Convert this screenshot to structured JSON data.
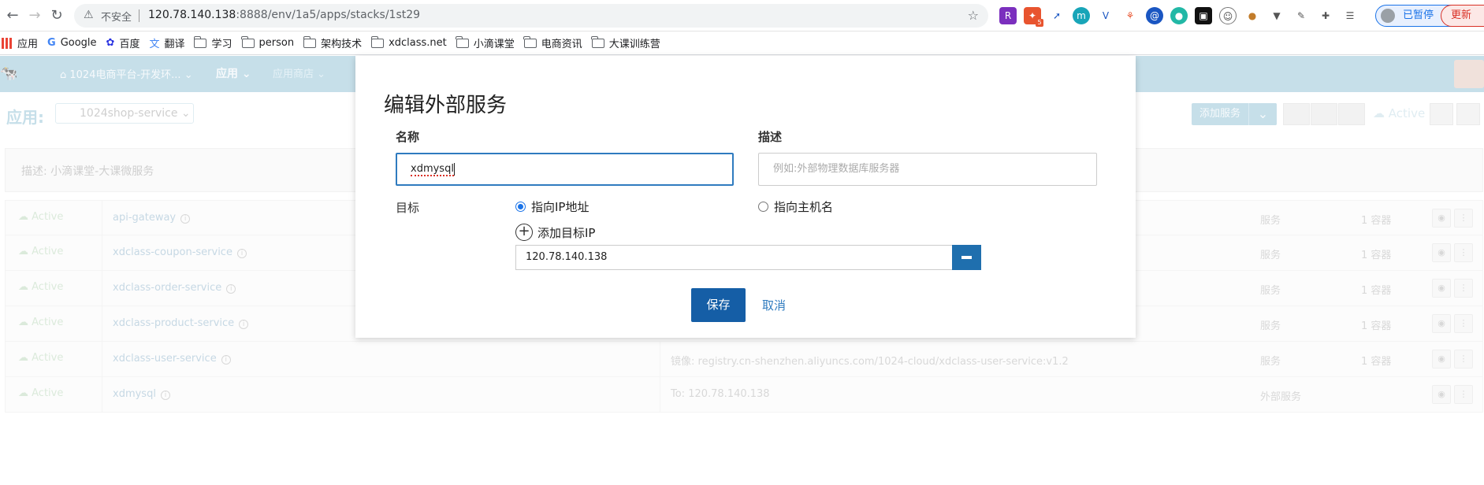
{
  "browser": {
    "insecure_label": "不安全",
    "url_host": "120.78.140.138",
    "url_rest": ":8888/env/1a5/apps/stacks/1st29",
    "paused_label": "已暂停",
    "update_label": "更新",
    "ext_badge": "5",
    "bookmarks": [
      {
        "label": "应用",
        "kind": "apps"
      },
      {
        "label": "Google",
        "kind": "google"
      },
      {
        "label": "百度",
        "kind": "baidu"
      },
      {
        "label": "翻译",
        "kind": "translate"
      },
      {
        "label": "学习",
        "kind": "folder"
      },
      {
        "label": "person",
        "kind": "folder"
      },
      {
        "label": "架构技术",
        "kind": "folder"
      },
      {
        "label": "xdclass.net",
        "kind": "folder"
      },
      {
        "label": "小滴课堂",
        "kind": "folder"
      },
      {
        "label": "电商资讯",
        "kind": "folder"
      },
      {
        "label": "大课训练营",
        "kind": "folder"
      }
    ]
  },
  "app": {
    "env_label": "1024电商平台-开发环...",
    "nav_apps": "应用",
    "nav_store": "应用商店",
    "page_title": "应用:",
    "stack_name": "1024shop-service",
    "add_service": "添加服务",
    "stack_state": "Active",
    "description": "描述: 小滴课堂-大课微服务",
    "services": [
      {
        "state": "Active",
        "name": "api-gateway",
        "detail": "",
        "kind": "服务",
        "scale": "1 容器"
      },
      {
        "state": "Active",
        "name": "xdclass-coupon-service",
        "detail": "",
        "kind": "服务",
        "scale": "1 容器"
      },
      {
        "state": "Active",
        "name": "xdclass-order-service",
        "detail": "",
        "kind": "服务",
        "scale": "1 容器"
      },
      {
        "state": "Active",
        "name": "xdclass-product-service",
        "detail": "",
        "kind": "服务",
        "scale": "1 容器"
      },
      {
        "state": "Active",
        "name": "xdclass-user-service",
        "detail": "镜像: registry.cn-shenzhen.aliyuncs.com/1024-cloud/xdclass-user-service:v1.2",
        "kind": "服务",
        "scale": "1 容器"
      },
      {
        "state": "Active",
        "name": "xdmysql",
        "detail": "To:  120.78.140.138",
        "kind": "外部服务",
        "scale": ""
      }
    ]
  },
  "modal": {
    "title": "编辑外部服务",
    "name_label": "名称",
    "name_value": "xdmysql",
    "desc_label": "描述",
    "desc_placeholder": "例如:外部物理数据库服务器",
    "target_label": "目标",
    "radio_ip": "指向IP地址",
    "radio_host": "指向主机名",
    "add_ip_label": "添加目标IP",
    "ip_value": "120.78.140.138",
    "save_label": "保存",
    "cancel_label": "取消"
  },
  "colors": {
    "primary": "#155ea6",
    "focus": "#2f7bbf",
    "nav_bg": "#a8cede"
  }
}
